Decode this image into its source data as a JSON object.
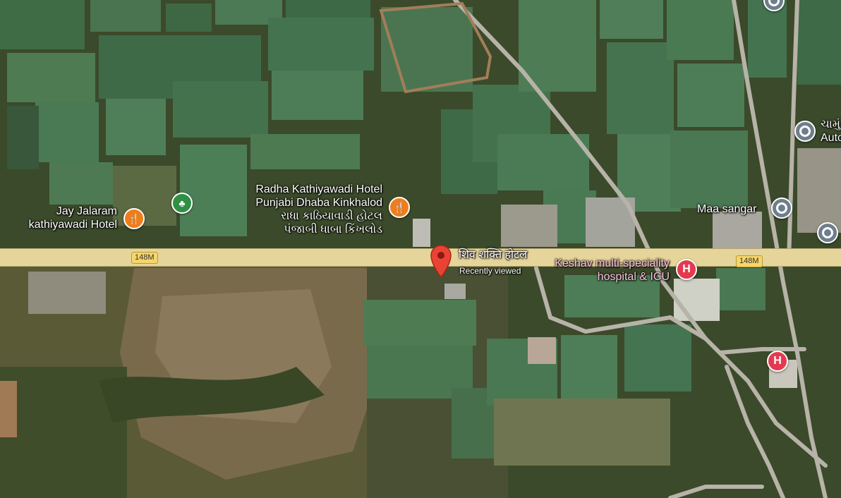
{
  "map": {
    "road_number": "148M",
    "road_number_2": "148M"
  },
  "selected_place": {
    "name": "शिव शक्ति होटल",
    "subtitle": "Recently viewed"
  },
  "places": {
    "jay_jalaram": {
      "line1": "Jay Jalaram",
      "line2": "kathiyawadi Hotel"
    },
    "radha": {
      "line1": "Radha Kathiyawadi Hotel",
      "line2": "Punjabi Dhaba Kinkhalod",
      "line3": "રાધા કાઠિયાવાડી હોટલ",
      "line4": "પંજાબી ધાબા કિંખલોડ"
    },
    "keshav": {
      "line1": "Keshav multi-speciality",
      "line2": "hospital & ICU"
    },
    "maa_sangar": {
      "label": "Maa sangar"
    },
    "chamunda": {
      "line1": "ચામું",
      "line2": "Auto"
    }
  },
  "icons": {
    "restaurant": "restaurant-icon",
    "park": "park-icon",
    "hospital": "hospital-icon",
    "place": "place-icon",
    "selected": "map-pin-icon"
  },
  "colors": {
    "road_main": "#e6d59a",
    "road_minor": "#b7b3a8",
    "restaurant_pin": "#f07d1a",
    "hospital_pin": "#e53950",
    "park_pin": "#2f8f45",
    "place_pin": "#6f7e8c",
    "selected_pin": "#ea4335",
    "hospital_label": "#ffc4dc"
  }
}
